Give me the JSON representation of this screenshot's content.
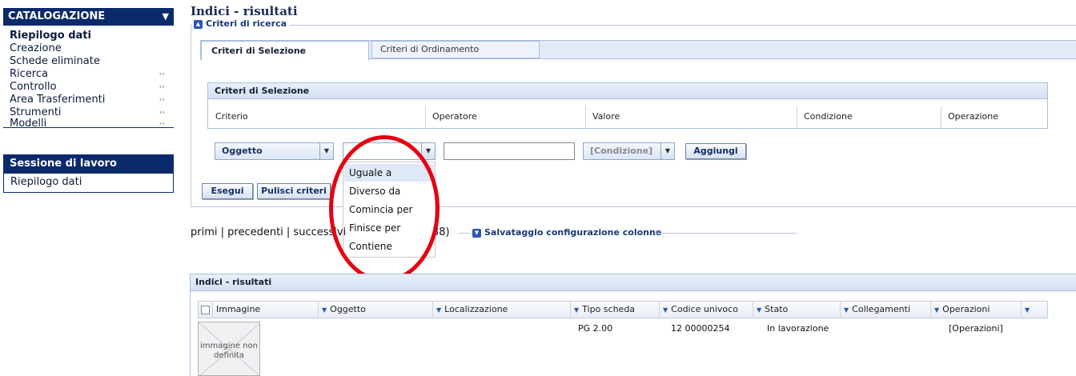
{
  "sidebar": {
    "header": "CATALOGAZIONE",
    "items": [
      {
        "label": "Riepilogo dati",
        "bold": true,
        "arrow": ""
      },
      {
        "label": "Creazione",
        "arrow": ""
      },
      {
        "label": "Schede eliminate",
        "arrow": ""
      },
      {
        "label": "Ricerca",
        "arrow": "››"
      },
      {
        "label": "Controllo",
        "arrow": "››"
      },
      {
        "label": "Area Trasferimenti",
        "arrow": "››"
      },
      {
        "label": "Strumenti",
        "arrow": "››"
      },
      {
        "label": "Modelli",
        "arrow": "››"
      }
    ],
    "session_header": "Sessione di lavoro",
    "session_item": "Riepilogo dati"
  },
  "page": {
    "title": "Indici - risultati",
    "search_legend": "Criteri di ricerca"
  },
  "tabs": [
    "Criteri di Selezione",
    "Criteri di Ordinamento"
  ],
  "criteria": {
    "title": "Criteri di Selezione",
    "columns": [
      "Criterio",
      "Operatore",
      "Valore",
      "Condizione",
      "Operazione"
    ],
    "criterio_value": "Oggetto",
    "operatore_value": "",
    "valore_value": "",
    "condizione_placeholder": "[Condizione]",
    "add_label": "Aggiungi",
    "operator_options": [
      "Uguale a",
      "Diverso da",
      "Comincia per",
      "Finisce per",
      "Contiene"
    ],
    "highlighted_option": 0
  },
  "actions": {
    "run_label": "Esegui",
    "clear_label": "Pulisci criteri"
  },
  "pagination": {
    "text": "primi | precedenti | successivi",
    "count": "38)",
    "save_columns_label": "Salvataggio configurazione colonne"
  },
  "results": {
    "title": "Indici - risultati",
    "columns": [
      "Immagine",
      "Oggetto",
      "Localizzazione",
      "Tipo scheda",
      "Codice univoco",
      "Stato",
      "Collegamenti",
      "Operazioni"
    ],
    "rows": [
      {
        "image_text": "immagine non definita",
        "oggetto": "",
        "localizzazione": "",
        "tipo": "PG 2.00",
        "codice": "12 00000254",
        "stato": "In lavorazione",
        "collegamenti": "",
        "operazioni": "[Operazioni]"
      }
    ]
  },
  "colors": {
    "nav_dark": "#0b2a6b",
    "accent_blue": "#2a56b4",
    "annotation_red": "#e60012"
  }
}
